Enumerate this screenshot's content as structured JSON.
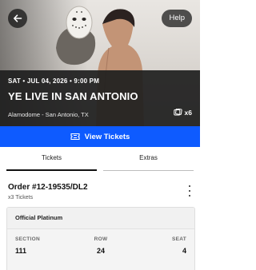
{
  "header": {
    "back_icon": "arrow-left-icon",
    "help_label": "Help"
  },
  "event": {
    "date_time": "SAT • JUL 04, 2026 • 9:00 PM",
    "title": "YE LIVE IN SAN ANTONIO",
    "venue": "Alamodome - San Antonio, TX",
    "ticket_icon": "tickets-icon",
    "ticket_count": "x6"
  },
  "cta": {
    "icon": "ticket-icon",
    "label": "View Tickets",
    "color": "#0e5bff"
  },
  "tabs": [
    {
      "label": "Tickets",
      "active": true
    },
    {
      "label": "Extras",
      "active": false
    }
  ],
  "order": {
    "number": "Order #12-19535/DL2",
    "tickets": "x3 Tickets",
    "menu_icon": "more-vertical-icon"
  },
  "ticket": {
    "type": "Official Platinum",
    "section_label": "SECTION",
    "section": "111",
    "row_label": "ROW",
    "row": "24",
    "seat_label": "SEAT",
    "seat": "4"
  }
}
